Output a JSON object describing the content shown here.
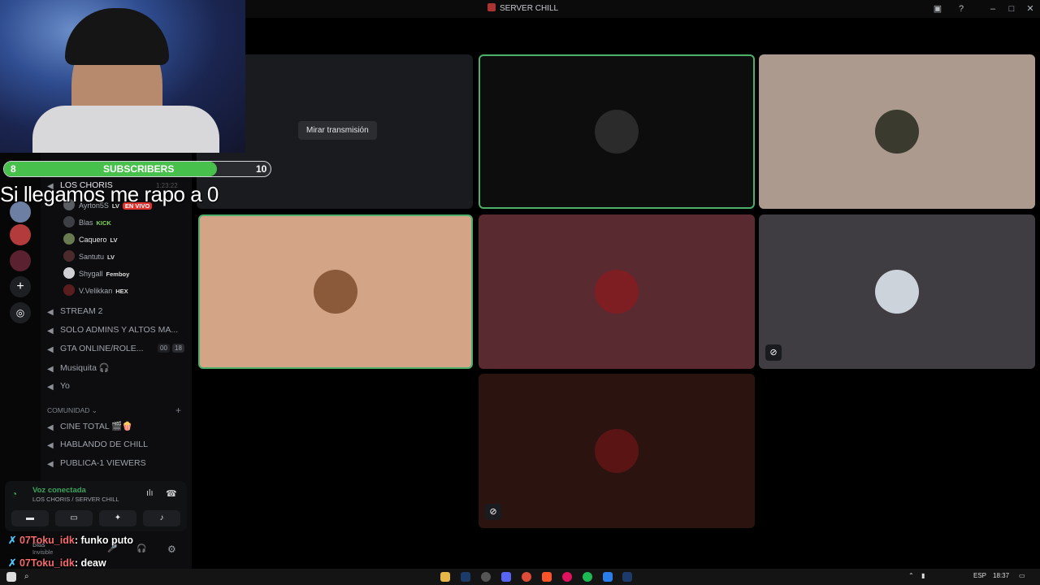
{
  "window": {
    "title": "SERVER CHILL"
  },
  "overlay": {
    "subscribers_current": "8",
    "subscribers_label": "SUBSCRIBERS",
    "subscribers_goal": "10",
    "subscribers_progress": 0.8,
    "goal_text": "Si llegamos me rapo a 0"
  },
  "sidebar": {
    "active_channel": {
      "name": "LOS CHORIS",
      "timer": "1:23:22"
    },
    "members": [
      {
        "name": "Ayrton5S",
        "badge": "LV",
        "status": "EN VIVO"
      },
      {
        "name": "Blas",
        "badge": "KICK"
      },
      {
        "name": "Caquero",
        "badge": "LV"
      },
      {
        "name": "Santutu",
        "badge": "LV"
      },
      {
        "name": "Shygall",
        "badge": "Femboy"
      },
      {
        "name": "V.Velikkan",
        "badge": "HEX"
      }
    ],
    "channels": [
      {
        "name": "STREAM 2"
      },
      {
        "name": "SOLO ADMINS Y ALTOS MA..."
      },
      {
        "name": "GTA ONLINE/ROLE...",
        "count_a": "00",
        "count_b": "18"
      },
      {
        "name": "Musiquita 🎧"
      },
      {
        "name": "Yo"
      }
    ],
    "category": "COMUNIDAD",
    "community_channels": [
      {
        "name": "CINE TOTAL 🎬🍿"
      },
      {
        "name": "HABLANDO DE CHILL"
      },
      {
        "name": "PUBLICA-1 VIEWERS"
      }
    ]
  },
  "voice_panel": {
    "status": "Voz conectada",
    "location": "LOS CHORIS / SERVER CHILL",
    "user_name": "Blas",
    "user_status": "Invisible"
  },
  "stream_tile": {
    "watch_label": "Mirar transmisión"
  },
  "tiles": [
    {
      "id": "stream",
      "bg": "#1a1b1e"
    },
    {
      "id": "user-2",
      "bg": "#0d0d0d",
      "border": "#4caf6a"
    },
    {
      "id": "user-3",
      "bg": "#ad9a8e"
    },
    {
      "id": "user-4",
      "bg": "#d4a487",
      "border": "#4caf6a"
    },
    {
      "id": "user-5",
      "bg": "#5a2a31"
    },
    {
      "id": "user-6",
      "bg": "#403d42",
      "muted": true
    },
    {
      "id": "user-7",
      "bg": "#2b1410",
      "muted": true
    }
  ],
  "chat": [
    {
      "user": "07Toku_idk",
      "message": "funko puto"
    },
    {
      "user": "07Toku_idk",
      "message": "deaw"
    }
  ],
  "taskbar": {
    "lang": "ESP",
    "time": "18:37"
  },
  "colors": {
    "accent_green": "#47c04c",
    "speaking_border": "#4caf6a",
    "chat_user": "#f56b6b"
  }
}
